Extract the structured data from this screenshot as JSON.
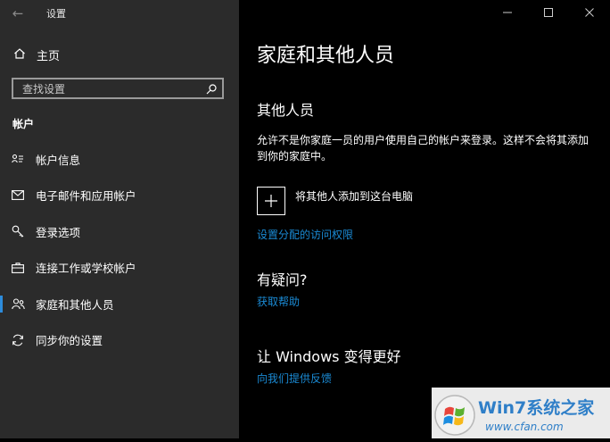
{
  "window": {
    "title": "设置",
    "controls": [
      "minimize-icon",
      "maximize-icon",
      "close-icon"
    ]
  },
  "sidebar": {
    "home_label": "主页",
    "search_placeholder": "查找设置",
    "section_header": "帐户",
    "items": [
      {
        "label": "帐户信息",
        "icon": "user-card-icon"
      },
      {
        "label": "电子邮件和应用帐户",
        "icon": "mail-icon"
      },
      {
        "label": "登录选项",
        "icon": "key-icon"
      },
      {
        "label": "连接工作或学校帐户",
        "icon": "briefcase-icon"
      },
      {
        "label": "家庭和其他人员",
        "icon": "people-icon",
        "active": true
      },
      {
        "label": "同步你的设置",
        "icon": "sync-icon"
      }
    ]
  },
  "main": {
    "title": "家庭和其他人员",
    "other_people": {
      "heading": "其他人员",
      "description": "允许不是你家庭一员的用户使用自己的帐户来登录。这样不会将其添加到你的家庭中。",
      "add_label": "将其他人添加到这台电脑",
      "assigned_access_link": "设置分配的访问权限"
    },
    "question": {
      "heading": "有疑问?",
      "link": "获取帮助"
    },
    "improve": {
      "heading": "让 Windows 变得更好",
      "link": "向我们提供反馈"
    }
  },
  "watermark": {
    "brand": "Win7系统之家",
    "url": "www.cfan.com"
  },
  "colors": {
    "sidebar_bg": "#2b2b2b",
    "main_bg": "#000000",
    "accent": "#1a8ad4",
    "active_indicator": "#2d8cdc"
  }
}
